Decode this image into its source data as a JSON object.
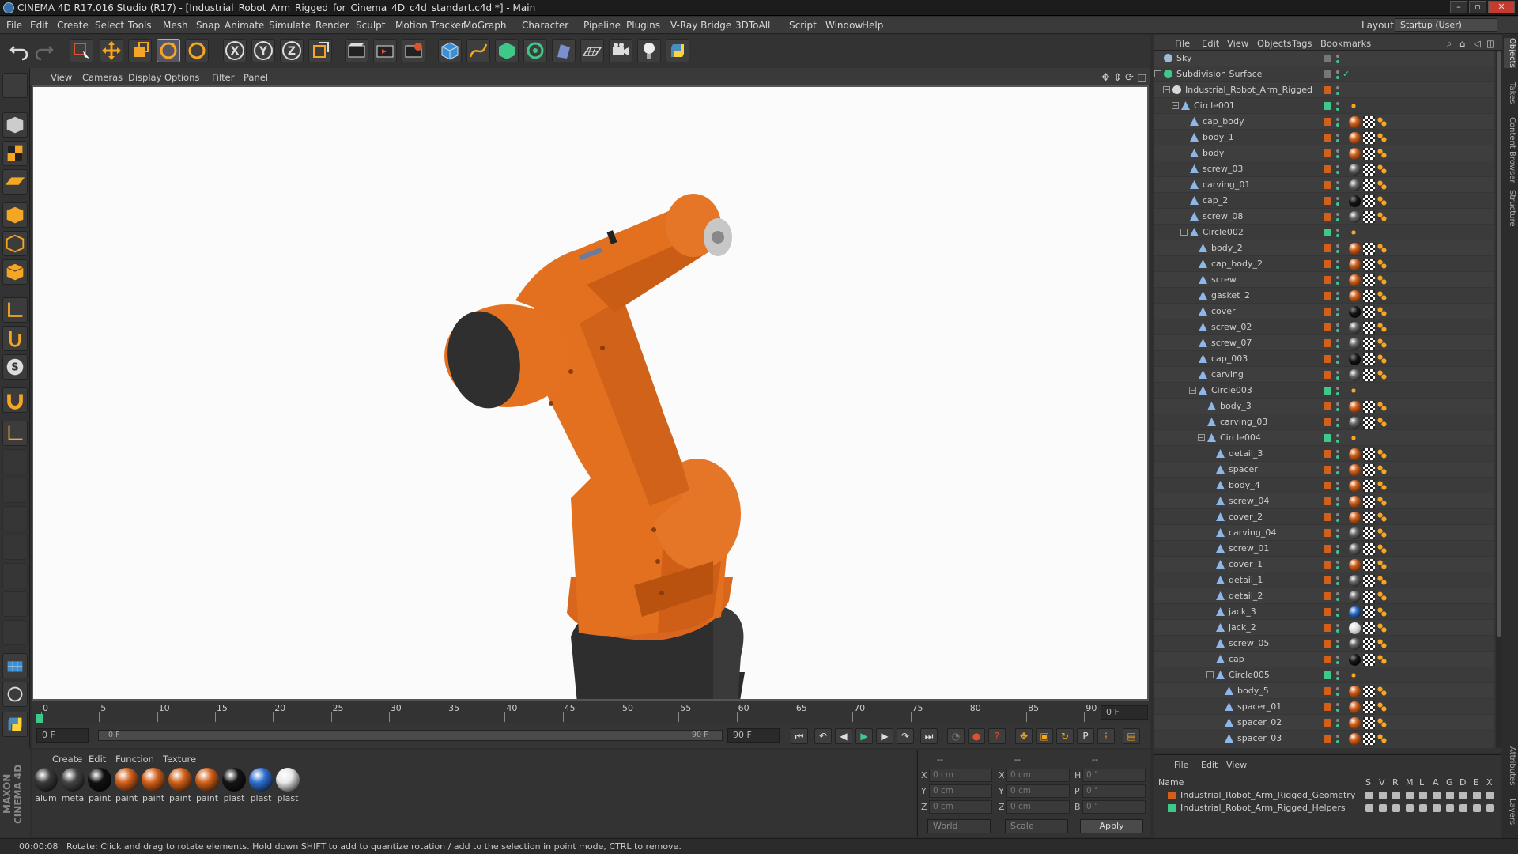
{
  "window": {
    "title": "CINEMA 4D R17.016 Studio (R17) - [Industrial_Robot_Arm_Rigged_for_Cinema_4D_c4d_standart.c4d *] - Main"
  },
  "menubar": {
    "items": [
      "File",
      "Edit",
      "Create",
      "Select",
      "Tools",
      "Mesh",
      "Snap",
      "Animate",
      "Simulate",
      "Render",
      "Sculpt",
      "Motion Tracker",
      "MoGraph",
      "Character",
      "Pipeline",
      "Plugins",
      "V-Ray Bridge",
      "3DToAll",
      "Script",
      "Window",
      "Help"
    ],
    "layout_label": "Layout:",
    "layout_value": "Startup (User)"
  },
  "viewport": {
    "menu": [
      "View",
      "Cameras",
      "Display",
      "Options",
      "Filter",
      "Panel"
    ]
  },
  "timeline": {
    "ticks": [
      "0",
      "5",
      "10",
      "15",
      "20",
      "25",
      "30",
      "35",
      "40",
      "45",
      "50",
      "55",
      "60",
      "65",
      "70",
      "75",
      "80",
      "85",
      "90"
    ],
    "current_frame_right": "0 F"
  },
  "playbar": {
    "start_frame": "0 F",
    "range_start": "0 F",
    "range_end": "90 F",
    "end_frame": "90 F"
  },
  "material_manager": {
    "menu": [
      "Create",
      "Edit",
      "Function",
      "Texture"
    ],
    "materials": [
      {
        "label": "alum",
        "color": "#3a3a3a"
      },
      {
        "label": "meta",
        "color": "#444444"
      },
      {
        "label": "paint",
        "color": "#111111"
      },
      {
        "label": "paint",
        "color": "#d2601a"
      },
      {
        "label": "paint",
        "color": "#d2601a"
      },
      {
        "label": "paint",
        "color": "#d2601a"
      },
      {
        "label": "paint",
        "color": "#d2601a"
      },
      {
        "label": "plast",
        "color": "#151515"
      },
      {
        "label": "plast",
        "color": "#2d6fd0"
      },
      {
        "label": "plast",
        "color": "#e8e8e8"
      }
    ]
  },
  "coordinates": {
    "header": [
      "--",
      "--",
      "--"
    ],
    "rows": [
      {
        "axis": "X",
        "pos": "0 cm",
        "size_axis": "X",
        "size": "0 cm",
        "rot_axis": "H",
        "rot": "0 °"
      },
      {
        "axis": "Y",
        "pos": "0 cm",
        "size_axis": "Y",
        "size": "0 cm",
        "rot_axis": "P",
        "rot": "0 °"
      },
      {
        "axis": "Z",
        "pos": "0 cm",
        "size_axis": "Z",
        "size": "0 cm",
        "rot_axis": "B",
        "rot": "0 °"
      }
    ],
    "mode": "World",
    "scale": "Scale",
    "apply": "Apply"
  },
  "object_manager": {
    "menu": [
      "File",
      "Edit",
      "View",
      "Objects",
      "Tags",
      "Bookmarks"
    ],
    "objects": [
      {
        "name": "Sky",
        "depth": 0,
        "kind": "sky",
        "vis": "#777",
        "tags": []
      },
      {
        "name": "Subdivision Surface",
        "depth": 0,
        "kind": "sub",
        "vis": "#777",
        "tags": [],
        "check": true
      },
      {
        "name": "Industrial_Robot_Arm_Rigged",
        "depth": 1,
        "kind": "null",
        "vis": "#d2601a",
        "tags": []
      },
      {
        "name": "Circle001",
        "depth": 2,
        "kind": "joint",
        "vis": "#3ec98a",
        "tags": [
          "j"
        ]
      },
      {
        "name": "cap_body",
        "depth": 3,
        "kind": "poly",
        "vis": "#d2601a",
        "tags": [
          "o",
          "c",
          "w"
        ]
      },
      {
        "name": "body_1",
        "depth": 3,
        "kind": "poly",
        "vis": "#d2601a",
        "tags": [
          "o",
          "c",
          "w"
        ]
      },
      {
        "name": "body",
        "depth": 3,
        "kind": "poly",
        "vis": "#d2601a",
        "tags": [
          "o",
          "c",
          "w"
        ]
      },
      {
        "name": "screw_03",
        "depth": 3,
        "kind": "poly",
        "vis": "#d2601a",
        "tags": [
          "g",
          "c",
          "w"
        ]
      },
      {
        "name": "carving_01",
        "depth": 3,
        "kind": "poly",
        "vis": "#d2601a",
        "tags": [
          "g",
          "c",
          "w"
        ]
      },
      {
        "name": "cap_2",
        "depth": 3,
        "kind": "poly",
        "vis": "#d2601a",
        "tags": [
          "k",
          "c",
          "w"
        ]
      },
      {
        "name": "screw_08",
        "depth": 3,
        "kind": "poly",
        "vis": "#d2601a",
        "tags": [
          "g",
          "c",
          "w"
        ]
      },
      {
        "name": "Circle002",
        "depth": 3,
        "kind": "joint",
        "vis": "#3ec98a",
        "tags": [
          "j"
        ]
      },
      {
        "name": "body_2",
        "depth": 4,
        "kind": "poly",
        "vis": "#d2601a",
        "tags": [
          "o",
          "c",
          "w"
        ]
      },
      {
        "name": "cap_body_2",
        "depth": 4,
        "kind": "poly",
        "vis": "#d2601a",
        "tags": [
          "o",
          "c",
          "w"
        ]
      },
      {
        "name": "screw",
        "depth": 4,
        "kind": "poly",
        "vis": "#d2601a",
        "tags": [
          "o",
          "c",
          "w"
        ]
      },
      {
        "name": "gasket_2",
        "depth": 4,
        "kind": "poly",
        "vis": "#d2601a",
        "tags": [
          "o",
          "c",
          "w"
        ]
      },
      {
        "name": "cover",
        "depth": 4,
        "kind": "poly",
        "vis": "#d2601a",
        "tags": [
          "k",
          "c",
          "w"
        ]
      },
      {
        "name": "screw_02",
        "depth": 4,
        "kind": "poly",
        "vis": "#d2601a",
        "tags": [
          "g",
          "c",
          "w"
        ]
      },
      {
        "name": "screw_07",
        "depth": 4,
        "kind": "poly",
        "vis": "#d2601a",
        "tags": [
          "g",
          "c",
          "w"
        ]
      },
      {
        "name": "cap_003",
        "depth": 4,
        "kind": "poly",
        "vis": "#d2601a",
        "tags": [
          "k",
          "c",
          "w"
        ]
      },
      {
        "name": "carving",
        "depth": 4,
        "kind": "poly",
        "vis": "#d2601a",
        "tags": [
          "g",
          "c",
          "w"
        ]
      },
      {
        "name": "Circle003",
        "depth": 4,
        "kind": "joint",
        "vis": "#3ec98a",
        "tags": [
          "j"
        ]
      },
      {
        "name": "body_3",
        "depth": 5,
        "kind": "poly",
        "vis": "#d2601a",
        "tags": [
          "o",
          "c",
          "w"
        ]
      },
      {
        "name": "carving_03",
        "depth": 5,
        "kind": "poly",
        "vis": "#d2601a",
        "tags": [
          "g",
          "c",
          "w"
        ]
      },
      {
        "name": "Circle004",
        "depth": 5,
        "kind": "joint",
        "vis": "#3ec98a",
        "tags": [
          "j"
        ]
      },
      {
        "name": "detail_3",
        "depth": 6,
        "kind": "poly",
        "vis": "#d2601a",
        "tags": [
          "o",
          "c",
          "w"
        ]
      },
      {
        "name": "spacer",
        "depth": 6,
        "kind": "poly",
        "vis": "#d2601a",
        "tags": [
          "o",
          "c",
          "w"
        ]
      },
      {
        "name": "body_4",
        "depth": 6,
        "kind": "poly",
        "vis": "#d2601a",
        "tags": [
          "o",
          "c",
          "w"
        ]
      },
      {
        "name": "screw_04",
        "depth": 6,
        "kind": "poly",
        "vis": "#d2601a",
        "tags": [
          "o",
          "c",
          "w"
        ]
      },
      {
        "name": "cover_2",
        "depth": 6,
        "kind": "poly",
        "vis": "#d2601a",
        "tags": [
          "o",
          "c",
          "w"
        ]
      },
      {
        "name": "carving_04",
        "depth": 6,
        "kind": "poly",
        "vis": "#d2601a",
        "tags": [
          "g",
          "c",
          "w"
        ]
      },
      {
        "name": "screw_01",
        "depth": 6,
        "kind": "poly",
        "vis": "#d2601a",
        "tags": [
          "g",
          "c",
          "w"
        ]
      },
      {
        "name": "cover_1",
        "depth": 6,
        "kind": "poly",
        "vis": "#d2601a",
        "tags": [
          "o",
          "c",
          "w"
        ]
      },
      {
        "name": "detail_1",
        "depth": 6,
        "kind": "poly",
        "vis": "#d2601a",
        "tags": [
          "g",
          "c",
          "w"
        ]
      },
      {
        "name": "detail_2",
        "depth": 6,
        "kind": "poly",
        "vis": "#d2601a",
        "tags": [
          "g",
          "c",
          "w"
        ]
      },
      {
        "name": "jack_3",
        "depth": 6,
        "kind": "poly",
        "vis": "#d2601a",
        "tags": [
          "b",
          "c",
          "w"
        ]
      },
      {
        "name": "jack_2",
        "depth": 6,
        "kind": "poly",
        "vis": "#d2601a",
        "tags": [
          "s",
          "c",
          "w"
        ]
      },
      {
        "name": "screw_05",
        "depth": 6,
        "kind": "poly",
        "vis": "#d2601a",
        "tags": [
          "g",
          "c",
          "w"
        ]
      },
      {
        "name": "cap",
        "depth": 6,
        "kind": "poly",
        "vis": "#d2601a",
        "tags": [
          "k",
          "c",
          "w"
        ]
      },
      {
        "name": "Circle005",
        "depth": 6,
        "kind": "joint",
        "vis": "#3ec98a",
        "tags": [
          "j"
        ]
      },
      {
        "name": "body_5",
        "depth": 7,
        "kind": "poly",
        "vis": "#d2601a",
        "tags": [
          "o",
          "c",
          "w"
        ]
      },
      {
        "name": "spacer_01",
        "depth": 7,
        "kind": "poly",
        "vis": "#d2601a",
        "tags": [
          "o",
          "c",
          "w"
        ]
      },
      {
        "name": "spacer_02",
        "depth": 7,
        "kind": "poly",
        "vis": "#d2601a",
        "tags": [
          "o",
          "c",
          "w"
        ]
      },
      {
        "name": "spacer_03",
        "depth": 7,
        "kind": "poly",
        "vis": "#d2601a",
        "tags": [
          "o",
          "c",
          "w"
        ]
      }
    ]
  },
  "layer_manager": {
    "menu": [
      "File",
      "Edit",
      "View"
    ],
    "name_header": "Name",
    "col_headers": [
      "S",
      "V",
      "R",
      "M",
      "L",
      "A",
      "G",
      "D",
      "E",
      "X"
    ],
    "layers": [
      {
        "name": "Industrial_Robot_Arm_Rigged_Geometry",
        "color": "#d2601a"
      },
      {
        "name": "Industrial_Robot_Arm_Rigged_Helpers",
        "color": "#3ec98a"
      }
    ]
  },
  "right_tabs": [
    "Objects",
    "Takes",
    "Content Browser",
    "Structure",
    "Attributes",
    "Layers"
  ],
  "statusbar": {
    "time": "00:00:08",
    "message": "Rotate: Click and drag to rotate elements. Hold down SHIFT to add to quantize rotation / add to the selection in point mode, CTRL to remove."
  },
  "branding": "MAXON CINEMA 4D"
}
